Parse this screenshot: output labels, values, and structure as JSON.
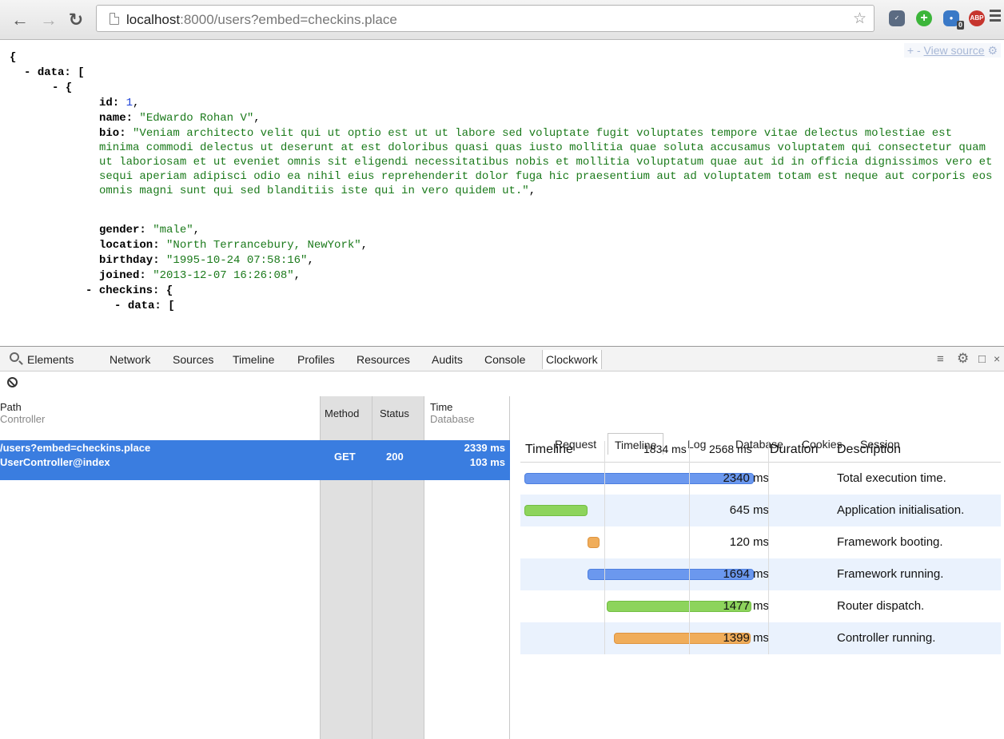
{
  "browser": {
    "url_host": "localhost",
    "url_rest": ":8000/users?embed=checkins.place",
    "extensions": {
      "ghost_badge": "0",
      "abp_label": "ABP"
    }
  },
  "json_view": {
    "view_source_prefix": "+ -",
    "view_source_label": "View source",
    "lines": {
      "open_brace": "{",
      "data_toggle": "- ",
      "data_key": "data:",
      "data_open": " [",
      "item_toggle": "- ",
      "item_open": "{",
      "id_key": "id:",
      "id_val": " 1",
      "comma": ",",
      "name_key": "name:",
      "name_val": " \"Edwardo Rohan V\"",
      "bio_key": "bio:",
      "bio_val": " \"Veniam architecto velit qui ut optio est ut ut labore sed voluptate fugit voluptates tempore vitae delectus molestiae est minima commodi delectus ut deserunt at est doloribus quasi quas iusto mollitia quae soluta accusamus voluptatem qui consectetur quam ut laboriosam et ut eveniet omnis sit eligendi necessitatibus nobis et mollitia voluptatum quae aut id in officia dignissimos vero et sequi aperiam adipisci odio ea nihil eius reprehenderit dolor fuga hic praesentium aut ad voluptatem totam est neque aut corporis eos omnis magni sunt qui sed blanditiis iste qui in vero quidem ut.\"",
      "gender_key": "gender:",
      "gender_val": " \"male\"",
      "location_key": "location:",
      "location_val": " \"North Terrancebury, NewYork\"",
      "birthday_key": "birthday:",
      "birthday_val": " \"1995-10-24 07:58:16\"",
      "joined_key": "joined:",
      "joined_val": " \"2013-12-07 16:26:08\"",
      "checkins_key": "checkins:",
      "checkins_open": " {",
      "inner_data_key": "data:",
      "inner_data_open": " ["
    }
  },
  "devtools": {
    "tabs": [
      "Elements",
      "Network",
      "Sources",
      "Timeline",
      "Profiles",
      "Resources",
      "Audits",
      "Console",
      "Clockwork"
    ],
    "active_tab": "Clockwork",
    "close_label": "×"
  },
  "requests": {
    "headers": {
      "path": "Path",
      "controller": "Controller",
      "method": "Method",
      "status": "Status",
      "time": "Time",
      "database": "Database"
    },
    "rows": [
      {
        "path": "/users?embed=checkins.place",
        "controller": "UserController@index",
        "method": "GET",
        "status": "200",
        "time": "2339 ms",
        "database": "103 ms"
      }
    ]
  },
  "detail": {
    "tabs": [
      "Request",
      "Timeline",
      "Log",
      "Database",
      "Cookies",
      "Session"
    ],
    "active_tab": "Timeline",
    "timeline": {
      "headers": {
        "timeline": "Timeline",
        "marker1": "1834 ms",
        "marker2": "2568 ms",
        "duration": "Duration",
        "description": "Description"
      },
      "rows": [
        {
          "duration": "2340 ms",
          "description": "Total execution time.",
          "color": "blue",
          "start": 0,
          "end": 2340
        },
        {
          "duration": "645 ms",
          "description": "Application initialisation.",
          "color": "green",
          "start": 0,
          "end": 645
        },
        {
          "duration": "120 ms",
          "description": "Framework booting.",
          "color": "orange",
          "start": 645,
          "end": 765
        },
        {
          "duration": "1694 ms",
          "description": "Framework running.",
          "color": "blue",
          "start": 646,
          "end": 2340
        },
        {
          "duration": "1477 ms",
          "description": "Router dispatch.",
          "color": "green",
          "start": 840,
          "end": 2317
        },
        {
          "duration": "1399 ms",
          "description": "Controller running.",
          "color": "orange",
          "start": 910,
          "end": 2309
        }
      ]
    }
  },
  "colors": {
    "selected_row": "#3a7de0",
    "json_string": "#1b7a1b",
    "json_number": "#1a3fd8",
    "bar_blue": "#6b98ee",
    "bar_green": "#8dd45c",
    "bar_orange": "#f0ad5a"
  }
}
